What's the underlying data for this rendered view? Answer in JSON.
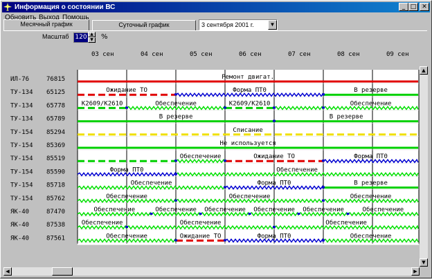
{
  "window": {
    "title": "Информация о состоянии ВС",
    "min_glyph": "_",
    "max_glyph": "□",
    "close_glyph": "✕"
  },
  "menu": [
    "Обновить",
    "Выход",
    "Помощь"
  ],
  "tabs": [
    {
      "label": "Месячный график",
      "active": true
    },
    {
      "label": "Суточный график",
      "active": false
    }
  ],
  "date_select": {
    "value": "3 сентября 2001 г.",
    "arrow": "▼"
  },
  "scale": {
    "label": "Масштаб",
    "value": "120",
    "unit": "%",
    "up": "▲",
    "down": "▼"
  },
  "days": [
    "03 сен",
    "04 сен",
    "05 сен",
    "06 сен",
    "07 сен",
    "08 сен",
    "09 сен"
  ],
  "colors": {
    "red": "#e00000",
    "green": "#00d000",
    "blue": "#0000d0",
    "yellow": "#f0e000",
    "wave_green": "#00e000"
  },
  "aircraft": [
    {
      "type": "ИЛ-76",
      "reg": "76815",
      "segments": [
        {
          "from": 0,
          "to": 7,
          "status": "Ремонт двигат.",
          "style": "red"
        }
      ]
    },
    {
      "type": "ТУ-134",
      "reg": "65125",
      "segments": [
        {
          "from": 0,
          "to": 2,
          "status": "Ожидание ТО",
          "style": "red-dash"
        },
        {
          "from": 2,
          "to": 5,
          "status": "Форма ПТ0",
          "style": "blue-wave"
        },
        {
          "from": 5,
          "to": 7,
          "status": "В резерве",
          "style": "green"
        }
      ]
    },
    {
      "type": "ТУ-134",
      "reg": "65778",
      "segments": [
        {
          "from": 0,
          "to": 1,
          "status": "К2609/К2610",
          "style": "green-dash"
        },
        {
          "from": 1,
          "to": 3,
          "status": "Обеспечение",
          "style": "green-wave"
        },
        {
          "from": 3,
          "to": 4,
          "status": "К2609/К2610",
          "style": "green-dash"
        },
        {
          "from": 4,
          "to": 5,
          "status": "",
          "style": "green-wave"
        },
        {
          "from": 5,
          "to": 7,
          "status": "Обеспечение",
          "style": "green-wave"
        }
      ]
    },
    {
      "type": "ТУ-134",
      "reg": "65789",
      "segments": [
        {
          "from": 0,
          "to": 4,
          "status": "В резерве",
          "style": "green"
        },
        {
          "from": 4,
          "to": 7,
          "status": "В резерве",
          "style": "green"
        }
      ]
    },
    {
      "type": "ТУ-154",
      "reg": "85294",
      "segments": [
        {
          "from": 0,
          "to": 7,
          "status": "Списание",
          "style": "yellow-dash"
        }
      ]
    },
    {
      "type": "ТУ-154",
      "reg": "85369",
      "segments": [
        {
          "from": 0,
          "to": 7,
          "status": "Не используется",
          "style": "green"
        }
      ]
    },
    {
      "type": "ТУ-154",
      "reg": "85519",
      "segments": [
        {
          "from": 0,
          "to": 2,
          "status": "",
          "style": "green-dash"
        },
        {
          "from": 2,
          "to": 3,
          "status": "Обеспечение",
          "style": "green-wave"
        },
        {
          "from": 3,
          "to": 5,
          "status": "Ожидание ТО",
          "style": "red-dash"
        },
        {
          "from": 5,
          "to": 7,
          "status": "Форма ПТ0",
          "style": "blue-wave"
        }
      ]
    },
    {
      "type": "ТУ-154",
      "reg": "85590",
      "segments": [
        {
          "from": 0,
          "to": 2,
          "status": "Форма ПТ0",
          "style": "blue-wave"
        },
        {
          "from": 2,
          "to": 7,
          "status": "Обеспечение",
          "style": "green-wave"
        }
      ]
    },
    {
      "type": "ТУ-154",
      "reg": "85718",
      "segments": [
        {
          "from": 0,
          "to": 3,
          "status": "Обеспечение",
          "style": "green-wave"
        },
        {
          "from": 3,
          "to": 5,
          "status": "Форма ПТ0",
          "style": "blue-wave"
        },
        {
          "from": 5,
          "to": 7,
          "status": "В резерве",
          "style": "green"
        }
      ]
    },
    {
      "type": "ТУ-154",
      "reg": "85762",
      "segments": [
        {
          "from": 0,
          "to": 2,
          "status": "Обеспечение",
          "style": "green-wave"
        },
        {
          "from": 2,
          "to": 5,
          "status": "Обеспечение",
          "style": "green-wave"
        },
        {
          "from": 5,
          "to": 7,
          "status": "Обеспечение",
          "style": "green-wave"
        }
      ]
    },
    {
      "type": "ЯК-40",
      "reg": "87470",
      "segments": [
        {
          "from": 0,
          "to": 1.5,
          "status": "Обеспечение",
          "style": "green-wave"
        },
        {
          "from": 1.5,
          "to": 2.5,
          "status": "Обеспечение",
          "style": "green-wave"
        },
        {
          "from": 2.5,
          "to": 3.5,
          "status": "Обеспечение",
          "style": "green-wave"
        },
        {
          "from": 3.5,
          "to": 4.5,
          "status": "Обеспечение",
          "style": "green-wave"
        },
        {
          "from": 4.5,
          "to": 5.5,
          "status": "Обеспечение",
          "style": "green-wave"
        },
        {
          "from": 5.5,
          "to": 7,
          "status": "Обеспечение",
          "style": "green-wave"
        }
      ]
    },
    {
      "type": "ЯК-40",
      "reg": "87538",
      "segments": [
        {
          "from": 0,
          "to": 1,
          "status": "Обеспечение",
          "style": "green-wave"
        },
        {
          "from": 1,
          "to": 4,
          "status": "Обеспечение",
          "style": "green-wave"
        },
        {
          "from": 4,
          "to": 7,
          "status": "Обеспечение",
          "style": "green-wave"
        }
      ]
    },
    {
      "type": "ЯК-40",
      "reg": "87561",
      "segments": [
        {
          "from": 0,
          "to": 2,
          "status": "Обеспечение",
          "style": "green-wave"
        },
        {
          "from": 2,
          "to": 3,
          "status": "Ожидание ТО",
          "style": "red-dash"
        },
        {
          "from": 3,
          "to": 5,
          "status": "Форма ПТ0",
          "style": "blue-wave"
        },
        {
          "from": 5,
          "to": 7,
          "status": "Обеспечение",
          "style": "green-wave"
        }
      ]
    }
  ],
  "scroll": {
    "up": "▲",
    "down": "▼",
    "left": "◀",
    "right": "▶"
  }
}
